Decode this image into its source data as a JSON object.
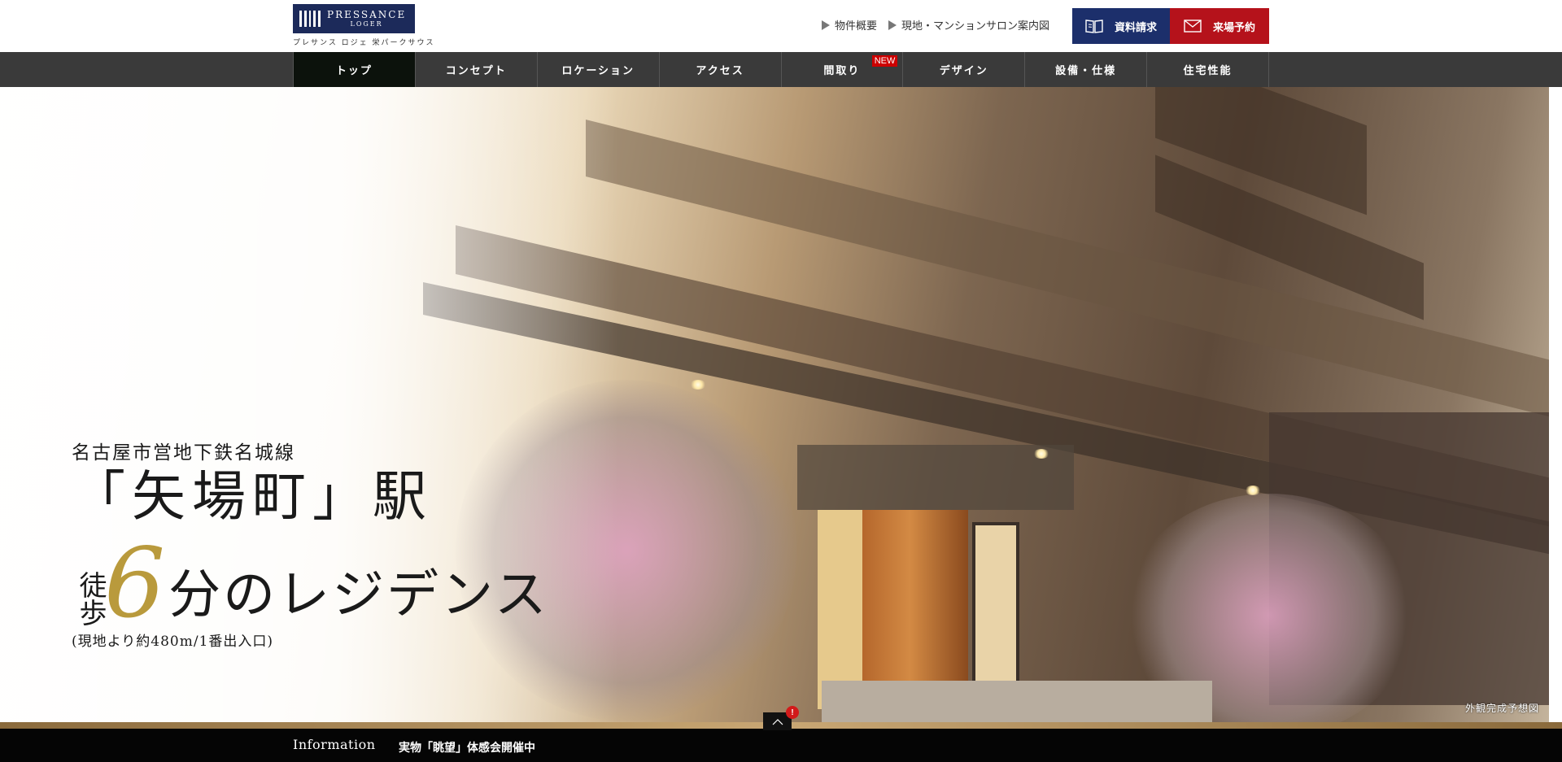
{
  "brand": {
    "logo_name": "PRESSANCE",
    "logo_sub": "LOGER",
    "logo_jp": "プレサンス ロジェ 栄パークサウス"
  },
  "header": {
    "links": [
      {
        "label": "物件概要"
      },
      {
        "label": "現地・マンションサロン案内図"
      }
    ],
    "request_button": "資料請求",
    "visit_button": "来場予約",
    "colors": {
      "request": "#1c2f6b",
      "visit": "#b5121b"
    }
  },
  "nav": {
    "items": [
      {
        "label": "トップ",
        "active": true
      },
      {
        "label": "コンセプト"
      },
      {
        "label": "ロケーション"
      },
      {
        "label": "アクセス"
      },
      {
        "label": "間取り",
        "badge": "NEW"
      },
      {
        "label": "デザイン"
      },
      {
        "label": "設備・仕様"
      },
      {
        "label": "住宅性能"
      }
    ]
  },
  "hero": {
    "line1": "名古屋市営地下鉄名城線",
    "line2": "「矢場町」駅",
    "toho": "徒歩",
    "minutes": "6",
    "rest": "分のレジデンス",
    "note": "(現地より約480m/1番出入口)",
    "caption": "外観完成予想図"
  },
  "info": {
    "label": "Information",
    "text": "実物「眺望」体感会開催中",
    "badge": "!"
  }
}
